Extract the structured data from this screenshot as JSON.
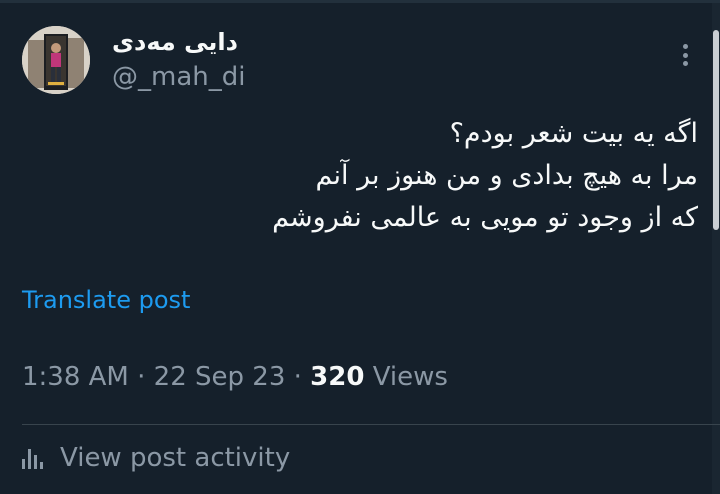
{
  "author": {
    "display_name": "دایی مه‌دی",
    "handle": "@_mah_di"
  },
  "tweet": {
    "lines": [
      "اگه یه بیت شعر بودم؟",
      "مرا به هیچ بدادی و من هنوز بر آنم",
      "که از وجود تو مویی به عالمی نفروشم"
    ]
  },
  "translate_label": "Translate post",
  "meta": {
    "time": "1:38 AM",
    "separator": "·",
    "date": "22 Sep 23",
    "views_count": "320",
    "views_label": "Views"
  },
  "activity_label": "View post activity",
  "icons": {
    "more": "more-vertical-icon",
    "activity": "analytics-bars-icon"
  },
  "colors": {
    "background": "#15202b",
    "text": "#f7f9f9",
    "secondary": "#8b98a5",
    "link": "#1d9bf0",
    "divider": "#38444d"
  }
}
